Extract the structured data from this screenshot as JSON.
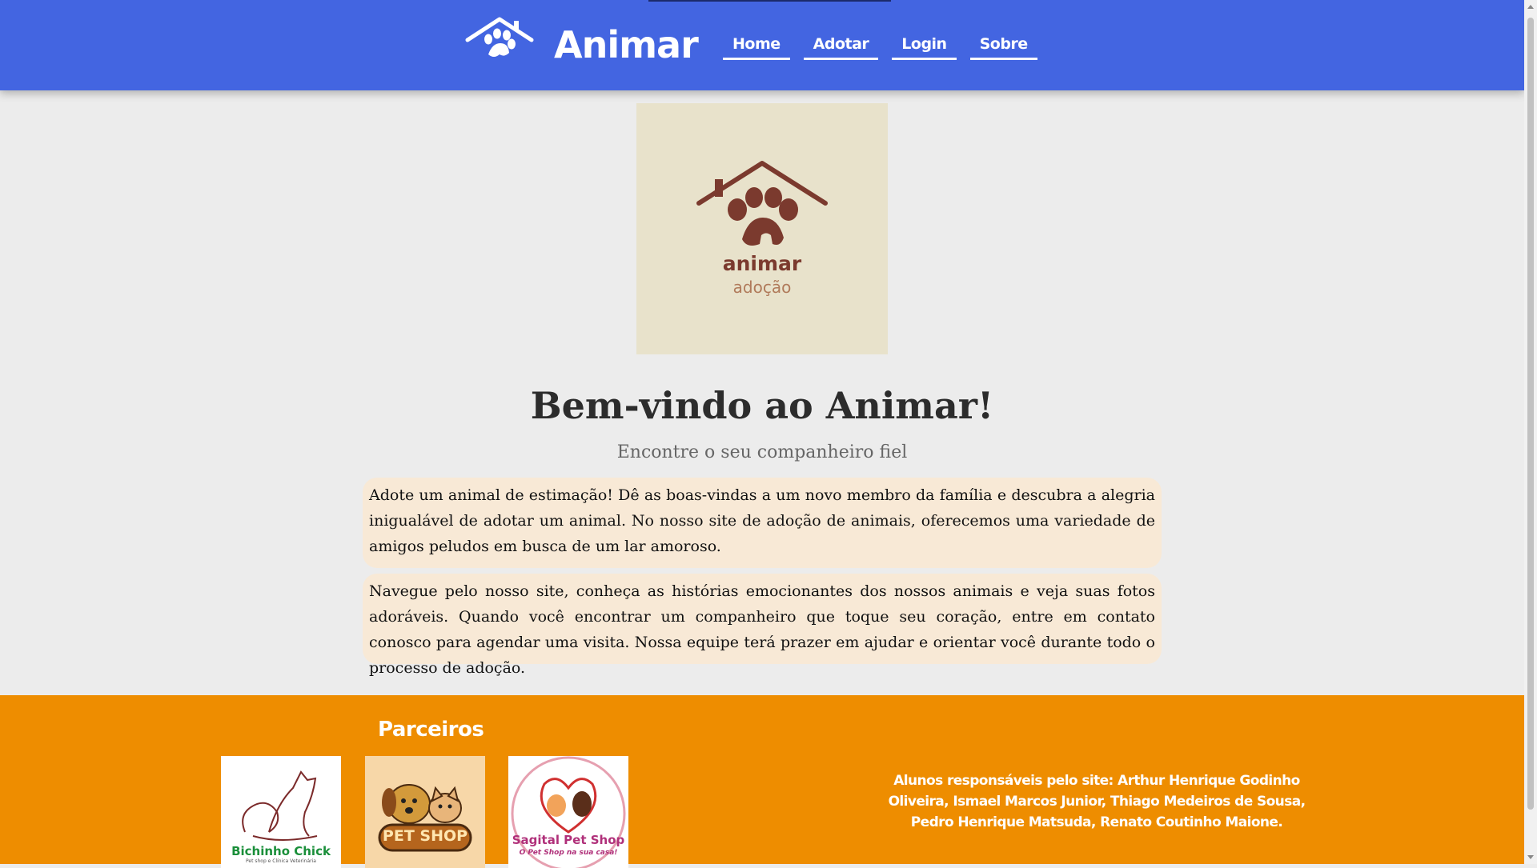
{
  "header": {
    "brand": "Animar",
    "nav": [
      {
        "label": "Home"
      },
      {
        "label": "Adotar"
      },
      {
        "label": "Login"
      },
      {
        "label": "Sobre"
      }
    ]
  },
  "hero": {
    "logo_name": "animar",
    "logo_sub": "adoção",
    "icon": "house-paw-icon"
  },
  "main": {
    "title": "Bem-vindo ao Animar!",
    "tagline": "Encontre o seu companheiro fiel",
    "paragraphs": [
      "Adote um animal de estimação! Dê as boas-vindas a um novo membro da família e descubra a alegria inigualável de adotar um animal. No nosso site de adoção de animais, oferecemos uma variedade de amigos peludos em busca de um lar amoroso.",
      "Navegue pelo nosso site, conheça as histórias emocionantes dos nossos animais e veja suas fotos adoráveis. Quando você encontrar um companheiro que toque seu coração, entre em contato conosco para agendar uma visita. Nossa equipe terá prazer em ajudar e orientar você durante todo o processo de adoção."
    ]
  },
  "footer": {
    "partners_title": "Parceiros",
    "partners": [
      {
        "name": "Bichinho Chick",
        "tagline": "Pet shop e Clínica Veterinária"
      },
      {
        "name": "PET SHOP"
      },
      {
        "name": "Sagital Pet Shop",
        "tagline": "O Pet Shop na sua casa!"
      }
    ],
    "credits": "Alunos responsáveis pelo site: Arthur Henrique Godinho Oliveira, Ismael Marcos Junior, Thiago Medeiros de Sousa, Pedro Henrique Matsuda, Renato Coutinho Maione."
  },
  "colors": {
    "header": "#4365e1",
    "footer": "#ee8d00",
    "paragraph_bg": "#f8e9d6",
    "logo_brown": "#7b3a2e"
  }
}
